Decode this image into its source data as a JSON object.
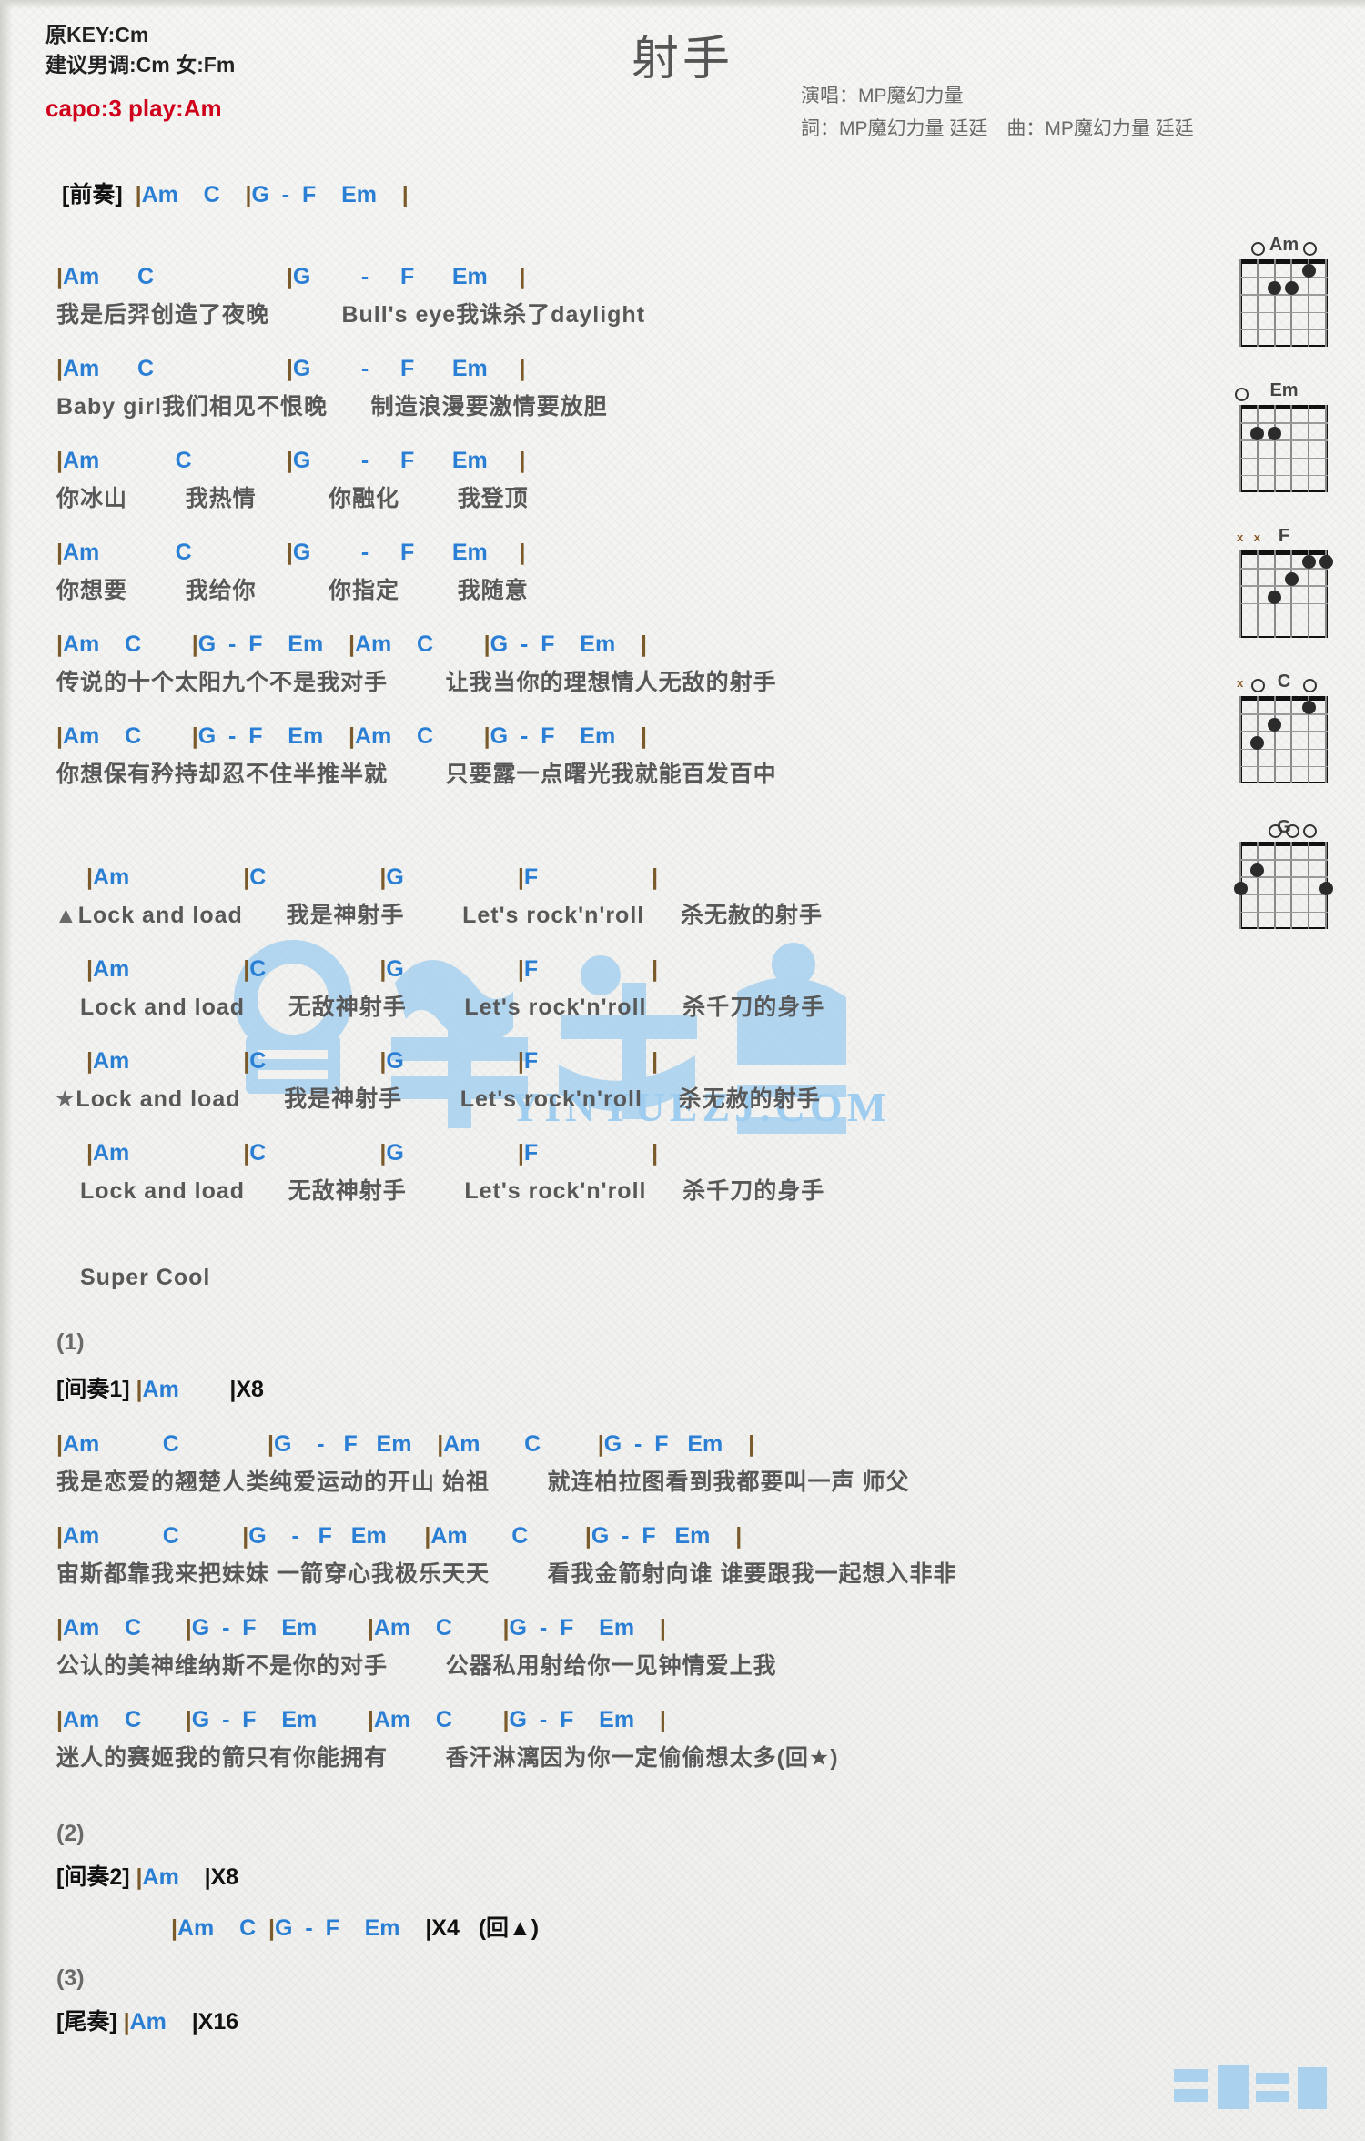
{
  "header": {
    "orig_key": "原KEY:Cm",
    "suggest_key": "建议男调:Cm 女:Fm",
    "capo": "capo:3 play:Am",
    "title": "射手",
    "singer": "演唱：MP魔幻力量",
    "writers": "詞：MP魔幻力量 廷廷　曲：MP魔幻力量 廷廷",
    "capo_color": "#d0021b",
    "chord_color": "#2a7fd4"
  },
  "intro": {
    "label": "[前奏]",
    "chords": "|Am    C    |G  -  F    Em    |"
  },
  "verse1": [
    {
      "chords": "|Am      C                     |G        -     F      Em     |",
      "lyric": "我是后羿创造了夜晚          Bull's eye我诛杀了daylight"
    },
    {
      "chords": "|Am      C                     |G        -     F      Em     |",
      "lyric": "Baby girl我们相见不恨晚      制造浪漫要激情要放胆"
    },
    {
      "chords": "|Am            C               |G        -     F      Em     |",
      "lyric": "你冰山        我热情          你融化        我登顶"
    },
    {
      "chords": "|Am            C               |G        -     F      Em     |",
      "lyric": "你想要        我给你          你指定        我随意"
    },
    {
      "chords": "|Am    C        |G  -  F    Em    |Am    C        |G  -  F    Em    |",
      "lyric": "传说的十个太阳九个不是我对手        让我当你的理想情人无敌的射手"
    },
    {
      "chords": "|Am    C        |G  -  F    Em    |Am    C        |G  -  F    Em    |",
      "lyric": "你想保有矜持却忍不住半推半就        只要露一点曙光我就能百发百中"
    }
  ],
  "chorus": [
    {
      "chords": " |Am                  |C                  |G                  |F                  |",
      "mark": "▲",
      "lyric": "Lock and load      我是神射手        Let's rock'n'roll     杀无赦的射手"
    },
    {
      "chords": " |Am                  |C                  |G                  |F                  |",
      "mark": "",
      "lyric": "Lock and load      无敌神射手        Let's rock'n'roll     杀千刀的身手"
    },
    {
      "chords": " |Am                  |C                  |G                  |F                  |",
      "mark": "★",
      "lyric": "Lock and load      我是神射手        Let's rock'n'roll     杀无赦的射手"
    },
    {
      "chords": " |Am                  |C                  |G                  |F                  |",
      "mark": "",
      "lyric": "Lock and load      无敌神射手        Let's rock'n'roll     杀千刀的身手"
    }
  ],
  "chorus_tail": "Super Cool",
  "interlude1": {
    "num": "(1)",
    "label": "[间奏1]",
    "chords": "|Am     |X8"
  },
  "verse2": [
    {
      "chords": "|Am          C              |G    -   F   Em    |Am       C         |G  -  F   Em    |",
      "lyric": "我是恋爱的翘楚人类纯爱运动的开山 始祖        就连柏拉图看到我都要叫一声 师父"
    },
    {
      "chords": "|Am          C          |G    -   F   Em      |Am       C         |G  -  F   Em    |",
      "lyric": "宙斯都靠我来把妹妹 一箭穿心我极乐天天        看我金箭射向谁 谁要跟我一起想入非非"
    },
    {
      "chords": "|Am    C       |G  -  F    Em        |Am    C        |G  -  F    Em    |",
      "lyric": "公认的美神维纳斯不是你的对手        公器私用射给你一见钟情爱上我"
    },
    {
      "chords": "|Am    C       |G  -  F    Em        |Am    C        |G  -  F    Em    |",
      "lyric": "迷人的赛姬我的箭只有你能拥有        香汗淋漓因为你一定偷偷想太多(回★)"
    }
  ],
  "interlude2": {
    "num": "(2)",
    "label": "[间奏2]",
    "chords": "|Am     |X8",
    "repeat_line": "|Am    C  |G  -  F    Em     |X4   (回▲)"
  },
  "outro": {
    "num": "(3)",
    "label": "[尾奏]",
    "chords": "|Am     |X16"
  },
  "diagrams": [
    {
      "name": "Am",
      "open": [
        1,
        4
      ],
      "mute": [],
      "dots": [
        {
          "s": 2,
          "f": 2
        },
        {
          "s": 3,
          "f": 2
        },
        {
          "s": 4,
          "f": 1
        }
      ]
    },
    {
      "name": "Em",
      "open": [
        0
      ],
      "mute": [],
      "dots": [
        {
          "s": 1,
          "f": 2
        },
        {
          "s": 2,
          "f": 2
        }
      ]
    },
    {
      "name": "F",
      "open": [],
      "mute": [
        0,
        1
      ],
      "dots": [
        {
          "s": 2,
          "f": 3
        },
        {
          "s": 3,
          "f": 2
        },
        {
          "s": 4,
          "f": 1
        },
        {
          "s": 5,
          "f": 1
        }
      ]
    },
    {
      "name": "C",
      "open": [
        1,
        4
      ],
      "mute": [
        0
      ],
      "dots": [
        {
          "s": 1,
          "f": 3
        },
        {
          "s": 2,
          "f": 2
        },
        {
          "s": 4,
          "f": 1
        }
      ]
    },
    {
      "name": "G",
      "open": [
        2,
        3,
        4
      ],
      "mute": [],
      "dots": [
        {
          "s": 0,
          "f": 3
        },
        {
          "s": 1,
          "f": 2
        },
        {
          "s": 5,
          "f": 3
        }
      ]
    }
  ],
  "watermark": {
    "brand_cn": "音樂之家",
    "brand_url": "YINYUEZJ.COM",
    "corner_cn": "音樂之家",
    "color": "#9fcdf0"
  }
}
